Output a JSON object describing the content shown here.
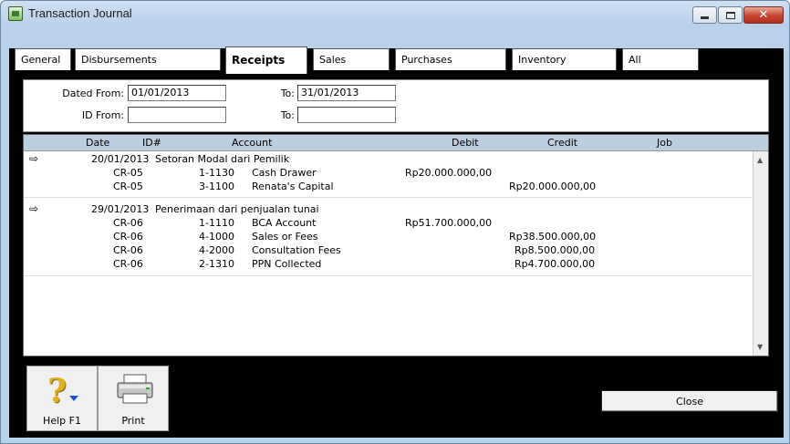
{
  "window": {
    "title": "Transaction Journal"
  },
  "tabs": [
    {
      "label": "General",
      "active": false
    },
    {
      "label": "Disbursements",
      "active": false
    },
    {
      "label": "Receipts",
      "active": true
    },
    {
      "label": "Sales",
      "active": false
    },
    {
      "label": "Purchases",
      "active": false
    },
    {
      "label": "Inventory",
      "active": false
    },
    {
      "label": "All",
      "active": false
    }
  ],
  "filters": {
    "dated_from_label": "Dated From:",
    "dated_from_value": "01/01/2013",
    "dated_to_label": "To:",
    "dated_to_value": "31/01/2013",
    "id_from_label": "ID From:",
    "id_from_value": "",
    "id_to_label": "To:",
    "id_to_value": ""
  },
  "columns": {
    "date": "Date",
    "id": "ID#",
    "account": "Account",
    "debit": "Debit",
    "credit": "Credit",
    "job": "Job"
  },
  "transactions": [
    {
      "date": "20/01/2013",
      "memo": "Setoran Modal dari Pemilik",
      "lines": [
        {
          "id": "CR-05",
          "acct_no": "1-1130",
          "acct_name": "Cash Drawer",
          "debit": "Rp20.000.000,00",
          "credit": ""
        },
        {
          "id": "CR-05",
          "acct_no": "3-1100",
          "acct_name": "Renata's Capital",
          "debit": "",
          "credit": "Rp20.000.000,00"
        }
      ]
    },
    {
      "date": "29/01/2013",
      "memo": "Penerimaan dari penjualan tunai",
      "lines": [
        {
          "id": "CR-06",
          "acct_no": "1-1110",
          "acct_name": "BCA Account",
          "debit": "Rp51.700.000,00",
          "credit": ""
        },
        {
          "id": "CR-06",
          "acct_no": "4-1000",
          "acct_name": "Sales or Fees",
          "debit": "",
          "credit": "Rp38.500.000,00"
        },
        {
          "id": "CR-06",
          "acct_no": "4-2000",
          "acct_name": "Consultation Fees",
          "debit": "",
          "credit": "Rp8.500.000,00"
        },
        {
          "id": "CR-06",
          "acct_no": "2-1310",
          "acct_name": "PPN Collected",
          "debit": "",
          "credit": "Rp4.700.000,00"
        }
      ]
    }
  ],
  "buttons": {
    "help": "Help F1",
    "print": "Print",
    "close": "Close"
  },
  "icons": {
    "window": "app-icon",
    "help": "help-icon",
    "print": "printer-icon",
    "zoom_arrow": "zoom-arrow-icon"
  }
}
